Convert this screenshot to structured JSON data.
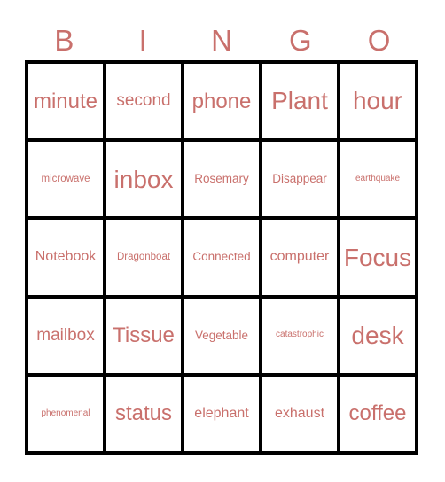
{
  "card": {
    "title": "BINGO Card",
    "text_color": "#c9706c",
    "grid_line_color": "#000000",
    "background_color": "#ffffff"
  },
  "header": {
    "letters": [
      "B",
      "I",
      "N",
      "G",
      "O"
    ]
  },
  "grid": {
    "columns": 5,
    "rows": 5,
    "cells": [
      [
        {
          "text": "minute",
          "size": "fs-xl"
        },
        {
          "text": "second",
          "size": "fs-l"
        },
        {
          "text": "phone",
          "size": "fs-xl"
        },
        {
          "text": "Plant",
          "size": "fs-xxl"
        },
        {
          "text": "hour",
          "size": "fs-xxl"
        }
      ],
      [
        {
          "text": "microwave",
          "size": "fs-xs"
        },
        {
          "text": "inbox",
          "size": "fs-xxl"
        },
        {
          "text": "Rosemary",
          "size": "fs-s"
        },
        {
          "text": "Disappear",
          "size": "fs-s"
        },
        {
          "text": "earthquake",
          "size": "fs-xxs"
        }
      ],
      [
        {
          "text": "Notebook",
          "size": "fs-m"
        },
        {
          "text": "Dragonboat",
          "size": "fs-xs"
        },
        {
          "text": "Connected",
          "size": "fs-s"
        },
        {
          "text": "computer",
          "size": "fs-m"
        },
        {
          "text": "Focus",
          "size": "fs-xxl"
        }
      ],
      [
        {
          "text": "mailbox",
          "size": "fs-l"
        },
        {
          "text": "Tissue",
          "size": "fs-xl"
        },
        {
          "text": "Vegetable",
          "size": "fs-s"
        },
        {
          "text": "catastrophic",
          "size": "fs-xxs"
        },
        {
          "text": "desk",
          "size": "fs-xxl"
        }
      ],
      [
        {
          "text": "phenomenal",
          "size": "fs-xxs"
        },
        {
          "text": "status",
          "size": "fs-xl"
        },
        {
          "text": "elephant",
          "size": "fs-m"
        },
        {
          "text": "exhaust",
          "size": "fs-m"
        },
        {
          "text": "coffee",
          "size": "fs-xl"
        }
      ]
    ]
  }
}
